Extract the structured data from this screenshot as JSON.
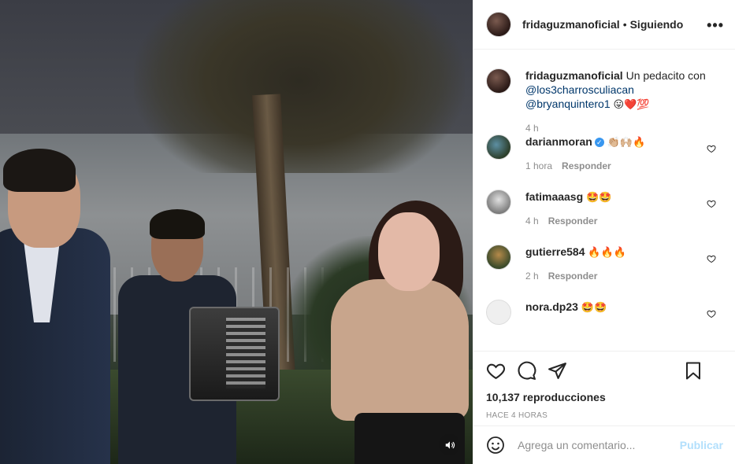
{
  "post": {
    "username": "fridaguzmanoficial",
    "separator": "•",
    "follow_status": "Siguiendo",
    "more_icon": "more-options-icon",
    "caption": {
      "username": "fridaguzmanoficial",
      "text": "Un pedacito con",
      "mention_1": "@los3charrosculiacan",
      "mention_2": "@bryanquintero1",
      "emojis": "😛❤️💯",
      "time": "4 h"
    }
  },
  "comments": [
    {
      "username": "darianmoran",
      "verified": true,
      "text": "👏🏼🙌🏼🔥",
      "time": "1 hora",
      "reply": "Responder"
    },
    {
      "username": "fatimaaasg",
      "text": "🤩🤩",
      "time": "4 h",
      "reply": "Responder"
    },
    {
      "username": "gutierre584",
      "text": "🔥🔥🔥",
      "time": "2 h",
      "reply": "Responder"
    },
    {
      "username": "nora.dp23",
      "text": "🤩🤩",
      "time": "",
      "reply": ""
    }
  ],
  "actions": {
    "views": "10,137 reproducciones",
    "posted": "HACE 4 HORAS"
  },
  "add_comment": {
    "placeholder": "Agrega un comentario...",
    "post_label": "Publicar"
  },
  "colors": {
    "link": "#00376b",
    "muted": "#8e8e8e",
    "publish_disabled": "#b2dffc",
    "verified": "#3897f0"
  }
}
